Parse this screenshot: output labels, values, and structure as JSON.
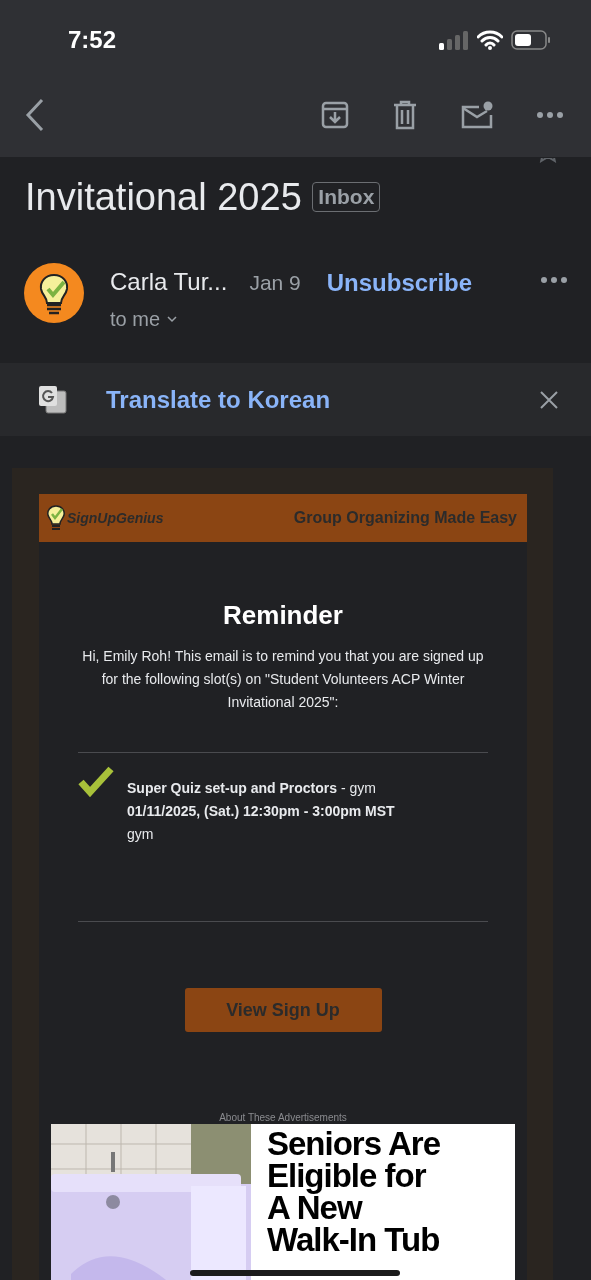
{
  "status_bar": {
    "time": "7:52"
  },
  "subject": "Invitational 2025",
  "label": "Inbox",
  "starred": false,
  "sender": {
    "name": "Carla Tur...",
    "date": "Jan 9",
    "recipient": "to me",
    "unsubscribe": "Unsubscribe"
  },
  "translate_bar": {
    "label": "Translate to Korean"
  },
  "email": {
    "logo": "SignUpGenius",
    "tagline": "Group Organizing Made Easy",
    "heading": "Reminder",
    "intro": "Hi, Emily Roh! This email is to remind you that you are signed up for the following slot(s) on \"Student Volunteers ACP Winter Invitational 2025\":",
    "slots": [
      {
        "title": "**Super Quiz set-up and Proctors** - gym",
        "time": "01/11/2025, (Sat.) 12:30pm - 3:00pm MST",
        "location": "gym",
        "checked": true
      }
    ],
    "button": "View Sign Up",
    "ad_label": "About These Advertisements",
    "ad_headline": [
      "Seniors Are",
      "Eligible for",
      "A New",
      "Walk-In Tub"
    ]
  }
}
